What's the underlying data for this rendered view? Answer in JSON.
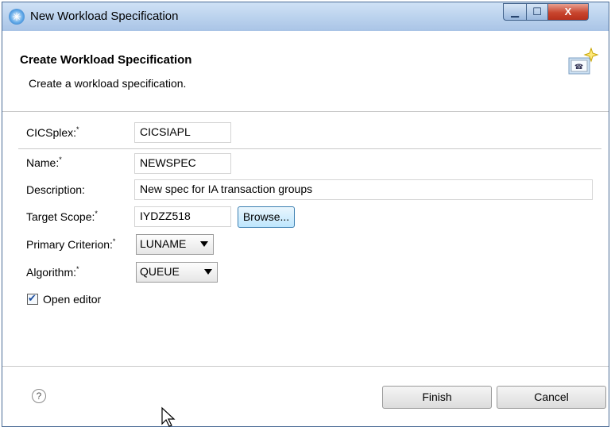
{
  "window": {
    "title": "New Workload Specification"
  },
  "header": {
    "title": "Create Workload Specification",
    "description": "Create a workload specification."
  },
  "form": {
    "required_marker": "*",
    "cicsplex": {
      "label": "CICSplex:",
      "value": "CICSIAPL"
    },
    "name": {
      "label": "Name:",
      "value": "NEWSPEC"
    },
    "description": {
      "label": "Description:",
      "value": "New spec for IA transaction groups"
    },
    "target_scope": {
      "label": "Target Scope:",
      "value": "IYDZZ518",
      "browse_label": "Browse..."
    },
    "primary_criterion": {
      "label": "Primary Criterion:",
      "value": "LUNAME"
    },
    "algorithm": {
      "label": "Algorithm:",
      "value": "QUEUE"
    },
    "open_editor": {
      "label": "Open editor",
      "checked": true
    }
  },
  "footer": {
    "help_icon": "question-mark",
    "finish_label": "Finish",
    "cancel_label": "Cancel"
  },
  "colors": {
    "titlebar": "#bcd3ee",
    "close_button": "#c8452e",
    "browse_button_border": "#3c7fb1",
    "checkbox_mark": "#1e4fa0"
  }
}
